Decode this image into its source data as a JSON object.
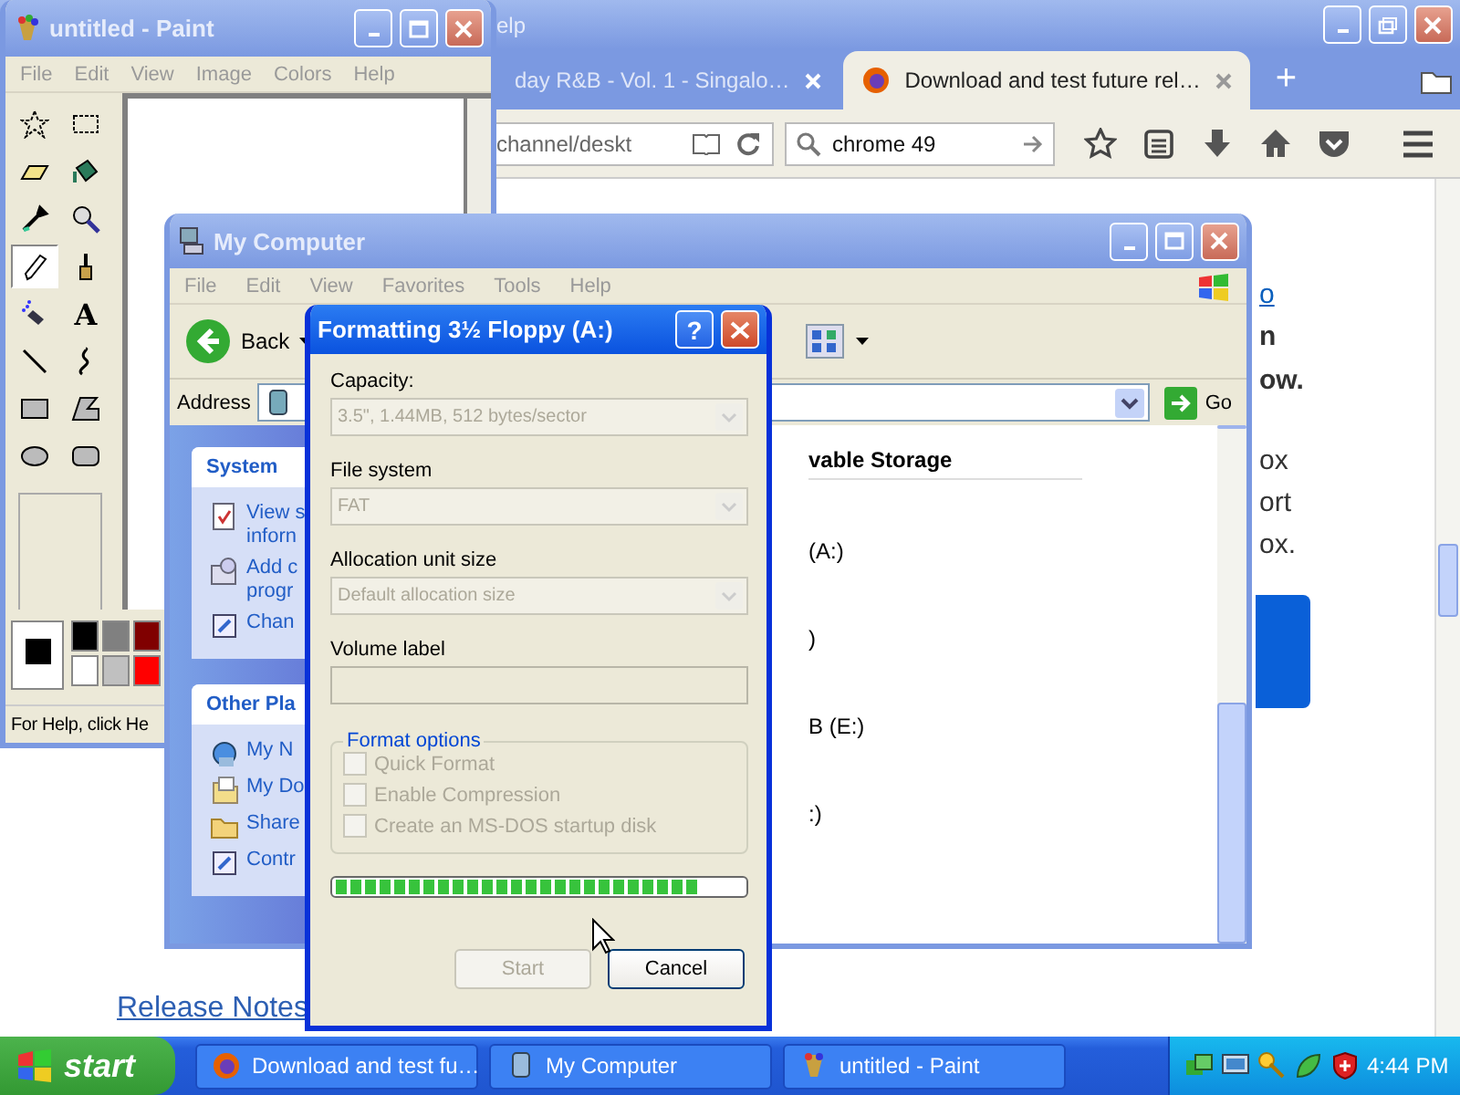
{
  "browser": {
    "title": "elp",
    "tabs": [
      {
        "label": "day R&B - Vol. 1 - Singalo…",
        "selected": false
      },
      {
        "label": "Download and test future rel…",
        "selected": true
      }
    ],
    "new_tab": "+",
    "address": "channel/deskt",
    "search": {
      "value": "chrome 49"
    },
    "page": {
      "lines": [
        {
          "text": "o",
          "kind": "link"
        },
        {
          "text": "n",
          "kind": "bold"
        },
        {
          "text": "ow.",
          "kind": "bold"
        },
        {
          "text": "ox",
          "kind": "body"
        },
        {
          "text": "ort",
          "kind": "body"
        },
        {
          "text": "ox.",
          "kind": "body"
        }
      ],
      "link": "Release Notes"
    }
  },
  "paint": {
    "title": "untitled - Paint",
    "menu": [
      "File",
      "Edit",
      "View",
      "Image",
      "Colors",
      "Help"
    ],
    "tools": [
      {
        "kind": "free-select",
        "selected": false
      },
      {
        "kind": "rect-select",
        "selected": false
      },
      {
        "kind": "eraser",
        "selected": false
      },
      {
        "kind": "fill",
        "selected": false
      },
      {
        "kind": "picker",
        "selected": false
      },
      {
        "kind": "magnifier",
        "selected": false
      },
      {
        "kind": "pencil",
        "selected": true
      },
      {
        "kind": "brush",
        "selected": false
      },
      {
        "kind": "airbrush",
        "selected": false
      },
      {
        "kind": "text",
        "glyph": "A",
        "selected": false
      },
      {
        "kind": "line",
        "selected": false
      },
      {
        "kind": "curve",
        "selected": false
      },
      {
        "kind": "rectangle",
        "selected": false
      },
      {
        "kind": "polygon",
        "selected": false
      },
      {
        "kind": "ellipse",
        "selected": false
      },
      {
        "kind": "rounded-rect",
        "selected": false
      }
    ],
    "palette": [
      {
        "color": "#000000"
      },
      {
        "color": "#808080"
      },
      {
        "color": "#800000"
      },
      {
        "color": "#ffffff"
      },
      {
        "color": "#c0c0c0"
      },
      {
        "color": "#ff0000"
      }
    ],
    "status": "For Help, click He"
  },
  "explorer": {
    "title": "My Computer",
    "menu": [
      "File",
      "Edit",
      "View",
      "Favorites",
      "Tools",
      "Help"
    ],
    "back": "Back",
    "address_label": "Address",
    "go": "Go",
    "panels": [
      {
        "title": "System",
        "items": [
          {
            "kind": "info",
            "lines": [
              "View s",
              "inforn"
            ]
          },
          {
            "kind": "programs",
            "lines": [
              "Add c",
              "progr"
            ]
          },
          {
            "kind": "settings",
            "lines": [
              "Chan"
            ]
          }
        ]
      },
      {
        "title": "Other Pla",
        "items": [
          {
            "kind": "network",
            "lines": [
              "My N"
            ]
          },
          {
            "kind": "documents",
            "lines": [
              "My Do"
            ]
          },
          {
            "kind": "folder",
            "lines": [
              "Share"
            ]
          },
          {
            "kind": "settings",
            "lines": [
              "Contr"
            ]
          }
        ]
      }
    ],
    "group_header": "vable Storage",
    "drives": [
      "(A:)",
      ")",
      "B (E:)",
      ":)"
    ]
  },
  "dialog": {
    "title": "Formatting 3½ Floppy (A:)",
    "help": "?",
    "fields": [
      {
        "label": "Capacity:",
        "value": "3.5\",  1.44MB, 512 bytes/sector",
        "kind": "select",
        "disabled": true
      },
      {
        "label": "File system",
        "value": "FAT",
        "kind": "select",
        "disabled": true
      },
      {
        "label": "Allocation unit size",
        "value": "Default allocation size",
        "kind": "select",
        "disabled": true
      },
      {
        "label": "Volume label",
        "kind": "input",
        "disabled": true
      }
    ],
    "options_title": "Format options",
    "options": [
      {
        "label": "Quick Format",
        "checked": false,
        "disabled": true
      },
      {
        "label": "Enable Compression",
        "checked": false,
        "disabled": true
      },
      {
        "label": "Create an MS-DOS startup disk",
        "checked": false,
        "disabled": true
      }
    ],
    "progress": {
      "level": 0.89
    },
    "buttons": [
      {
        "label": "Start",
        "disabled": true
      },
      {
        "label": "Cancel",
        "disabled": false
      }
    ]
  },
  "taskbar": {
    "start": "start",
    "tasks": [
      {
        "label": "Download and test fu…",
        "kind": "browser",
        "selected": false
      },
      {
        "label": "My Computer",
        "kind": "computer",
        "selected": false
      },
      {
        "label": "untitled - Paint",
        "kind": "paint",
        "selected": false
      }
    ],
    "clock": "4:44 PM"
  }
}
